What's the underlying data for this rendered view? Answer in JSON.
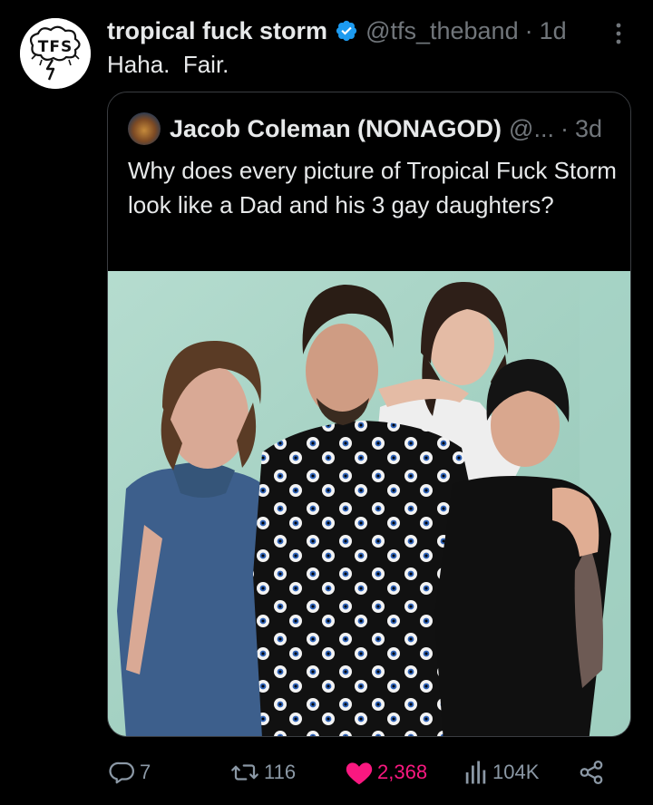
{
  "post": {
    "author_name": "tropical fuck storm",
    "author_handle": "@tfs_theband",
    "separator": "·",
    "time": "1d",
    "avatar_text": "TFS",
    "text": "Haha.  Fair."
  },
  "quoted_post": {
    "author_name": "Jacob Coleman (NONAGOD)",
    "author_handle": "@...",
    "separator": "·",
    "time": "3d",
    "text": "Why does every picture of Tropical Fuck Storm look like a Dad and his 3 gay daughters?"
  },
  "actions": {
    "replies": "7",
    "reposts": "116",
    "likes": "2,368",
    "views": "104K"
  },
  "colors": {
    "background": "#000000",
    "text_primary": "#e7e9ea",
    "text_secondary": "#71767b",
    "verified_blue": "#1d9bf0",
    "like_pink": "#f91880",
    "border": "#3a3d41"
  },
  "icons": {
    "verified": "verified-badge-icon",
    "more": "more-vertical-icon",
    "reply": "reply-icon",
    "repost": "repost-icon",
    "like": "heart-filled-icon",
    "views": "views-bar-chart-icon",
    "share": "share-icon"
  }
}
